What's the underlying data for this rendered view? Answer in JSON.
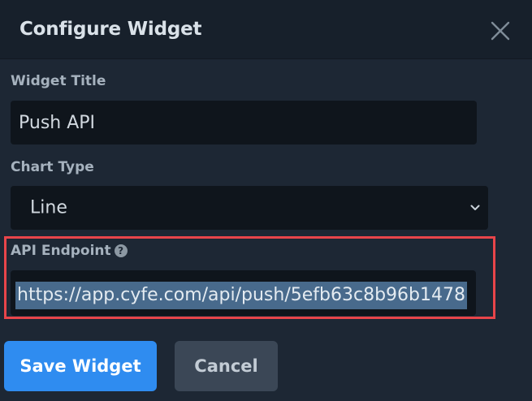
{
  "dialog": {
    "title": "Configure Widget"
  },
  "form": {
    "widget_title": {
      "label": "Widget Title",
      "value": "Push API"
    },
    "chart_type": {
      "label": "Chart Type",
      "selected": "Line"
    },
    "api_endpoint": {
      "label": "API Endpoint",
      "help_glyph": "?",
      "value": "https://app.cyfe.com/api/push/5efb63c8b96b1478"
    }
  },
  "buttons": {
    "save_label": "Save Widget",
    "cancel_label": "Cancel"
  },
  "colors": {
    "primary": "#2f8cf0",
    "highlight_border": "#e8454a",
    "background": "#1d2734",
    "input_background": "#0f151c",
    "selection": "#486a8c"
  },
  "icons": {
    "close": "close-icon",
    "chevron": "chevron-down-icon",
    "help": "help-icon"
  }
}
